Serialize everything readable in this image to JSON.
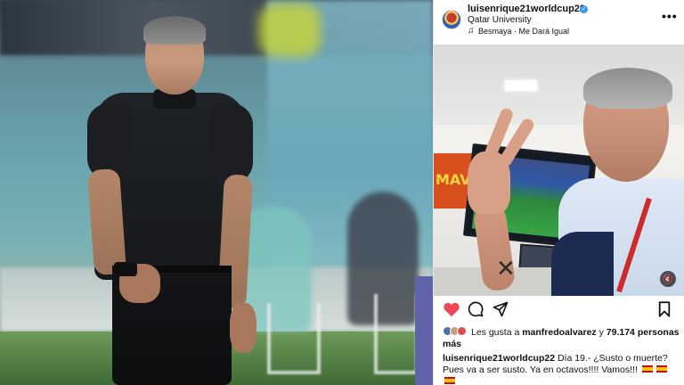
{
  "post": {
    "username": "luisenrique21worldcup22",
    "location": "Qatar University",
    "music_text": "Besmaya · Me Dará Igual",
    "icons": {
      "verified": "verified-badge-icon",
      "music": "music-note-icon",
      "more": "more-options-icon",
      "like": "heart-icon",
      "comment": "comment-icon",
      "share": "share-icon",
      "save": "bookmark-icon",
      "mute": "muted-audio-icon"
    },
    "photo_banner_text": "MAV",
    "likes": {
      "prefix": "Les gusta a",
      "user": "manfredoalvarez",
      "connector": "y",
      "count": "79.174",
      "suffix": "personas más"
    },
    "caption": {
      "username": "luisenrique21worldcup22",
      "text": "Día 19.- ¿Susto o muerte? Pues va a ser susto. Ya en octavos!!!! Vamos!!!"
    }
  },
  "colors": {
    "like_red": "#ed4956",
    "verified_blue": "#3897f0",
    "text": "#111111"
  }
}
